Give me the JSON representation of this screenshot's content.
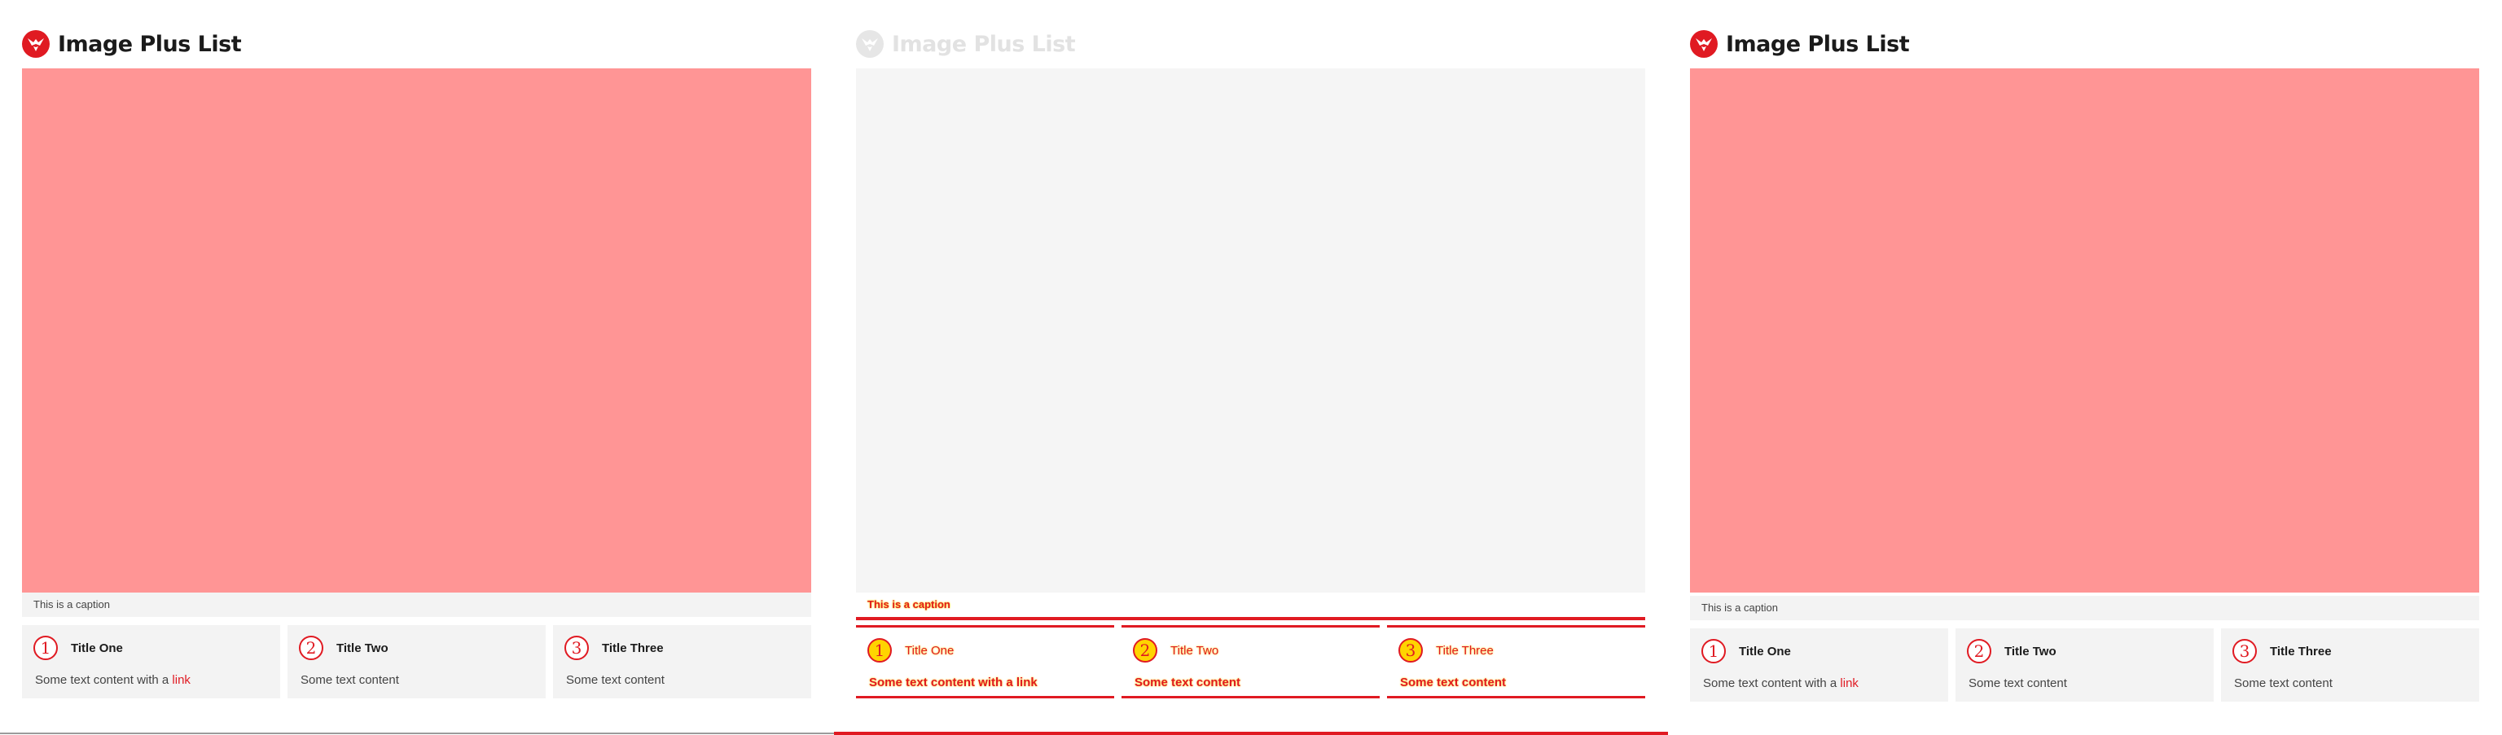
{
  "panels": [
    {
      "title": "Image Plus List",
      "logo_icon": "eagle-logo-icon",
      "caption": "This is a caption",
      "items": [
        {
          "number": "1",
          "title": "Title One",
          "text": "Some text content with a ",
          "link": "link"
        },
        {
          "number": "2",
          "title": "Title Two",
          "text": "Some text content",
          "link": ""
        },
        {
          "number": "3",
          "title": "Title Three",
          "text": "Some text content",
          "link": ""
        }
      ]
    },
    {
      "title": "Image Plus List",
      "logo_icon": "eagle-logo-icon",
      "caption": "This is a caption",
      "items": [
        {
          "number": "1",
          "title": "Title One",
          "text": "Some text content with a ",
          "link": "link"
        },
        {
          "number": "2",
          "title": "Title Two",
          "text": "Some text content",
          "link": ""
        },
        {
          "number": "3",
          "title": "Title Three",
          "text": "Some text content",
          "link": ""
        }
      ]
    },
    {
      "title": "Image Plus List",
      "logo_icon": "eagle-logo-icon",
      "caption": "This is a caption",
      "items": [
        {
          "number": "1",
          "title": "Title One",
          "text": "Some text content with a ",
          "link": "link"
        },
        {
          "number": "2",
          "title": "Title Two",
          "text": "Some text content",
          "link": ""
        },
        {
          "number": "3",
          "title": "Title Three",
          "text": "Some text content",
          "link": ""
        }
      ]
    }
  ],
  "colors": {
    "accent": "#e01a22",
    "image_fill": "#ff9595",
    "diff_highlight": "#ffd400",
    "card_bg": "#f3f3f3"
  }
}
